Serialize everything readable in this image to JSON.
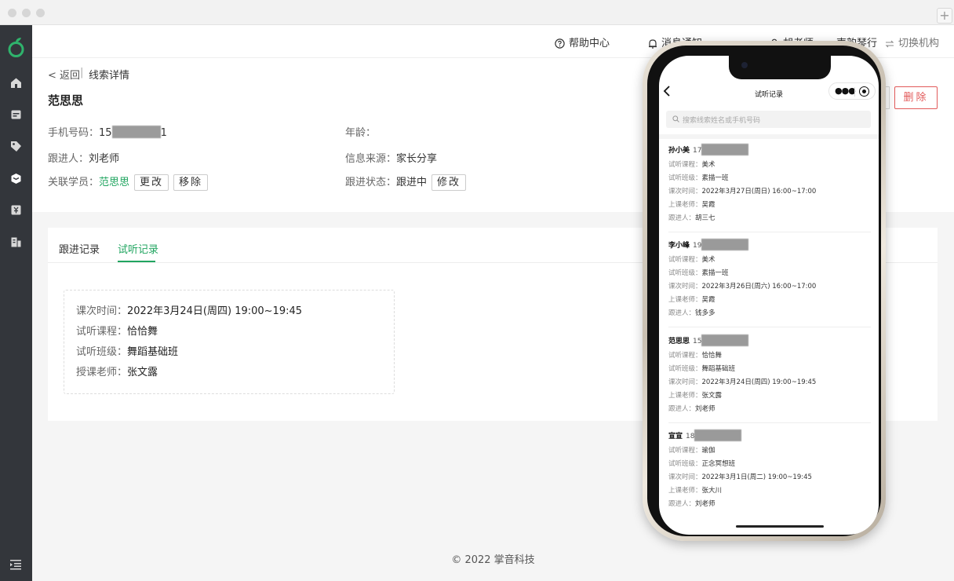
{
  "topbar": {
    "help": "帮助中心",
    "notify": "消息通知",
    "user": "胡老师",
    "org": "声韵琴行",
    "switch_org": "切换机构"
  },
  "detail": {
    "back": "< 返回",
    "separator": "|",
    "breadcrumb": "线索详情",
    "name": "范思思",
    "phone_label": "手机号码：",
    "phone_prefix": "15",
    "phone_suffix": "1",
    "age_label": "年龄：",
    "follower_label": "跟进人：",
    "follower": "刘老师",
    "source_label": "信息来源：",
    "source": "家长分享",
    "student_label": "关联学员：",
    "student": "范思思",
    "change_btn": "更改",
    "remove_btn": "移除",
    "status_label": "跟进状态：",
    "status": "跟进中",
    "edit_btn": "修改",
    "delete_btn": "删除"
  },
  "records": {
    "tabs": [
      {
        "label": "跟进记录",
        "active": false
      },
      {
        "label": "试听记录",
        "active": true
      }
    ],
    "trial": {
      "time_label": "课次时间：",
      "time": "2022年3月24日(周四) 19:00~19:45",
      "course_label": "试听课程：",
      "course": "恰恰舞",
      "class_label": "试听班级：",
      "class": "舞蹈基础班",
      "teacher_label": "授课老师：",
      "teacher": "张文露"
    }
  },
  "footer": "© 2022 掌音科技",
  "mobile": {
    "title": "试听记录",
    "search_placeholder": "搜索线索姓名或手机号码",
    "labels": {
      "course": "试听课程：",
      "class": "试听班级：",
      "time": "课次时间：",
      "teacher": "上课老师：",
      "follower": "跟进人："
    },
    "cards": [
      {
        "name": "孙小美",
        "phone_prefix": "17",
        "course": "美术",
        "class": "素描一班",
        "time": "2022年3月27日(周日) 16:00~17:00",
        "teacher": "吴霞",
        "follower": "胡三七"
      },
      {
        "name": "李小峰",
        "phone_prefix": "19",
        "course": "美术",
        "class": "素描一班",
        "time": "2022年3月26日(周六) 16:00~17:00",
        "teacher": "吴霞",
        "follower": "钱多多"
      },
      {
        "name": "范思思",
        "phone_prefix": "15",
        "course": "恰恰舞",
        "class": "舞蹈基础班",
        "time": "2022年3月24日(周四) 19:00~19:45",
        "teacher": "张文露",
        "follower": "刘老师"
      },
      {
        "name": "宣宣",
        "phone_prefix": "18",
        "course": "瑜伽",
        "class": "正念冥想班",
        "time": "2022年3月1日(周二) 19:00~19:45",
        "teacher": "张大川",
        "follower": "刘老师"
      }
    ]
  },
  "colors": {
    "accent": "#21a560",
    "danger": "#e25a5a",
    "sidebar": "#33363b"
  }
}
